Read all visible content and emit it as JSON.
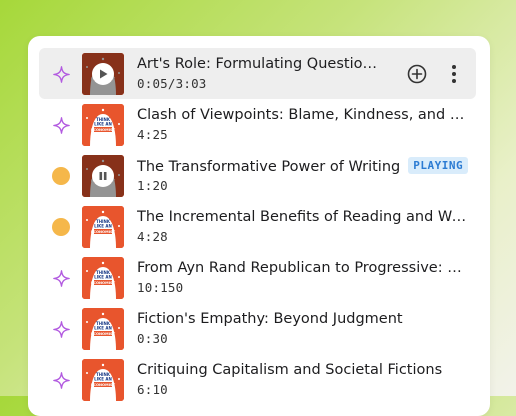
{
  "tracks": [
    {
      "title": "Art's Role: Formulating Questions,...",
      "duration": "0:05/3:03",
      "status": "new",
      "state": "selected"
    },
    {
      "title": "Clash of Viewpoints: Blame, Kindness, and Jud...",
      "duration": "4:25",
      "status": "new",
      "state": ""
    },
    {
      "title": "The Transformative Power of Writing",
      "duration": "1:20",
      "status": "partial",
      "state": "playing",
      "badge": "PLAYING"
    },
    {
      "title": "The Incremental Benefits of Reading and Writing",
      "duration": "4:28",
      "status": "partial",
      "state": ""
    },
    {
      "title": "From Ayn Rand Republican to Progressive: An...",
      "duration": "10:150",
      "status": "new",
      "state": ""
    },
    {
      "title": "Fiction's Empathy: Beyond Judgment",
      "duration": "0:30",
      "status": "new",
      "state": ""
    },
    {
      "title": "Critiquing Capitalism and Societal Fictions",
      "duration": "6:10",
      "status": "new",
      "state": ""
    }
  ],
  "cover_text": {
    "line1": "THINK",
    "line2": "LIKE AN",
    "line3": "ECONOMIST"
  },
  "colors": {
    "sparkle": "#b25ae0",
    "dot": "#f5b74a",
    "badge_bg": "#d9ecfb",
    "badge_text": "#2b7bd3",
    "cover": "#e8552d"
  },
  "icons": {
    "new": "sparkle-icon",
    "partial": "progress-dot-icon",
    "add": "add-circle-icon",
    "more": "more-vertical-icon",
    "play": "play-icon",
    "pause": "pause-icon"
  }
}
